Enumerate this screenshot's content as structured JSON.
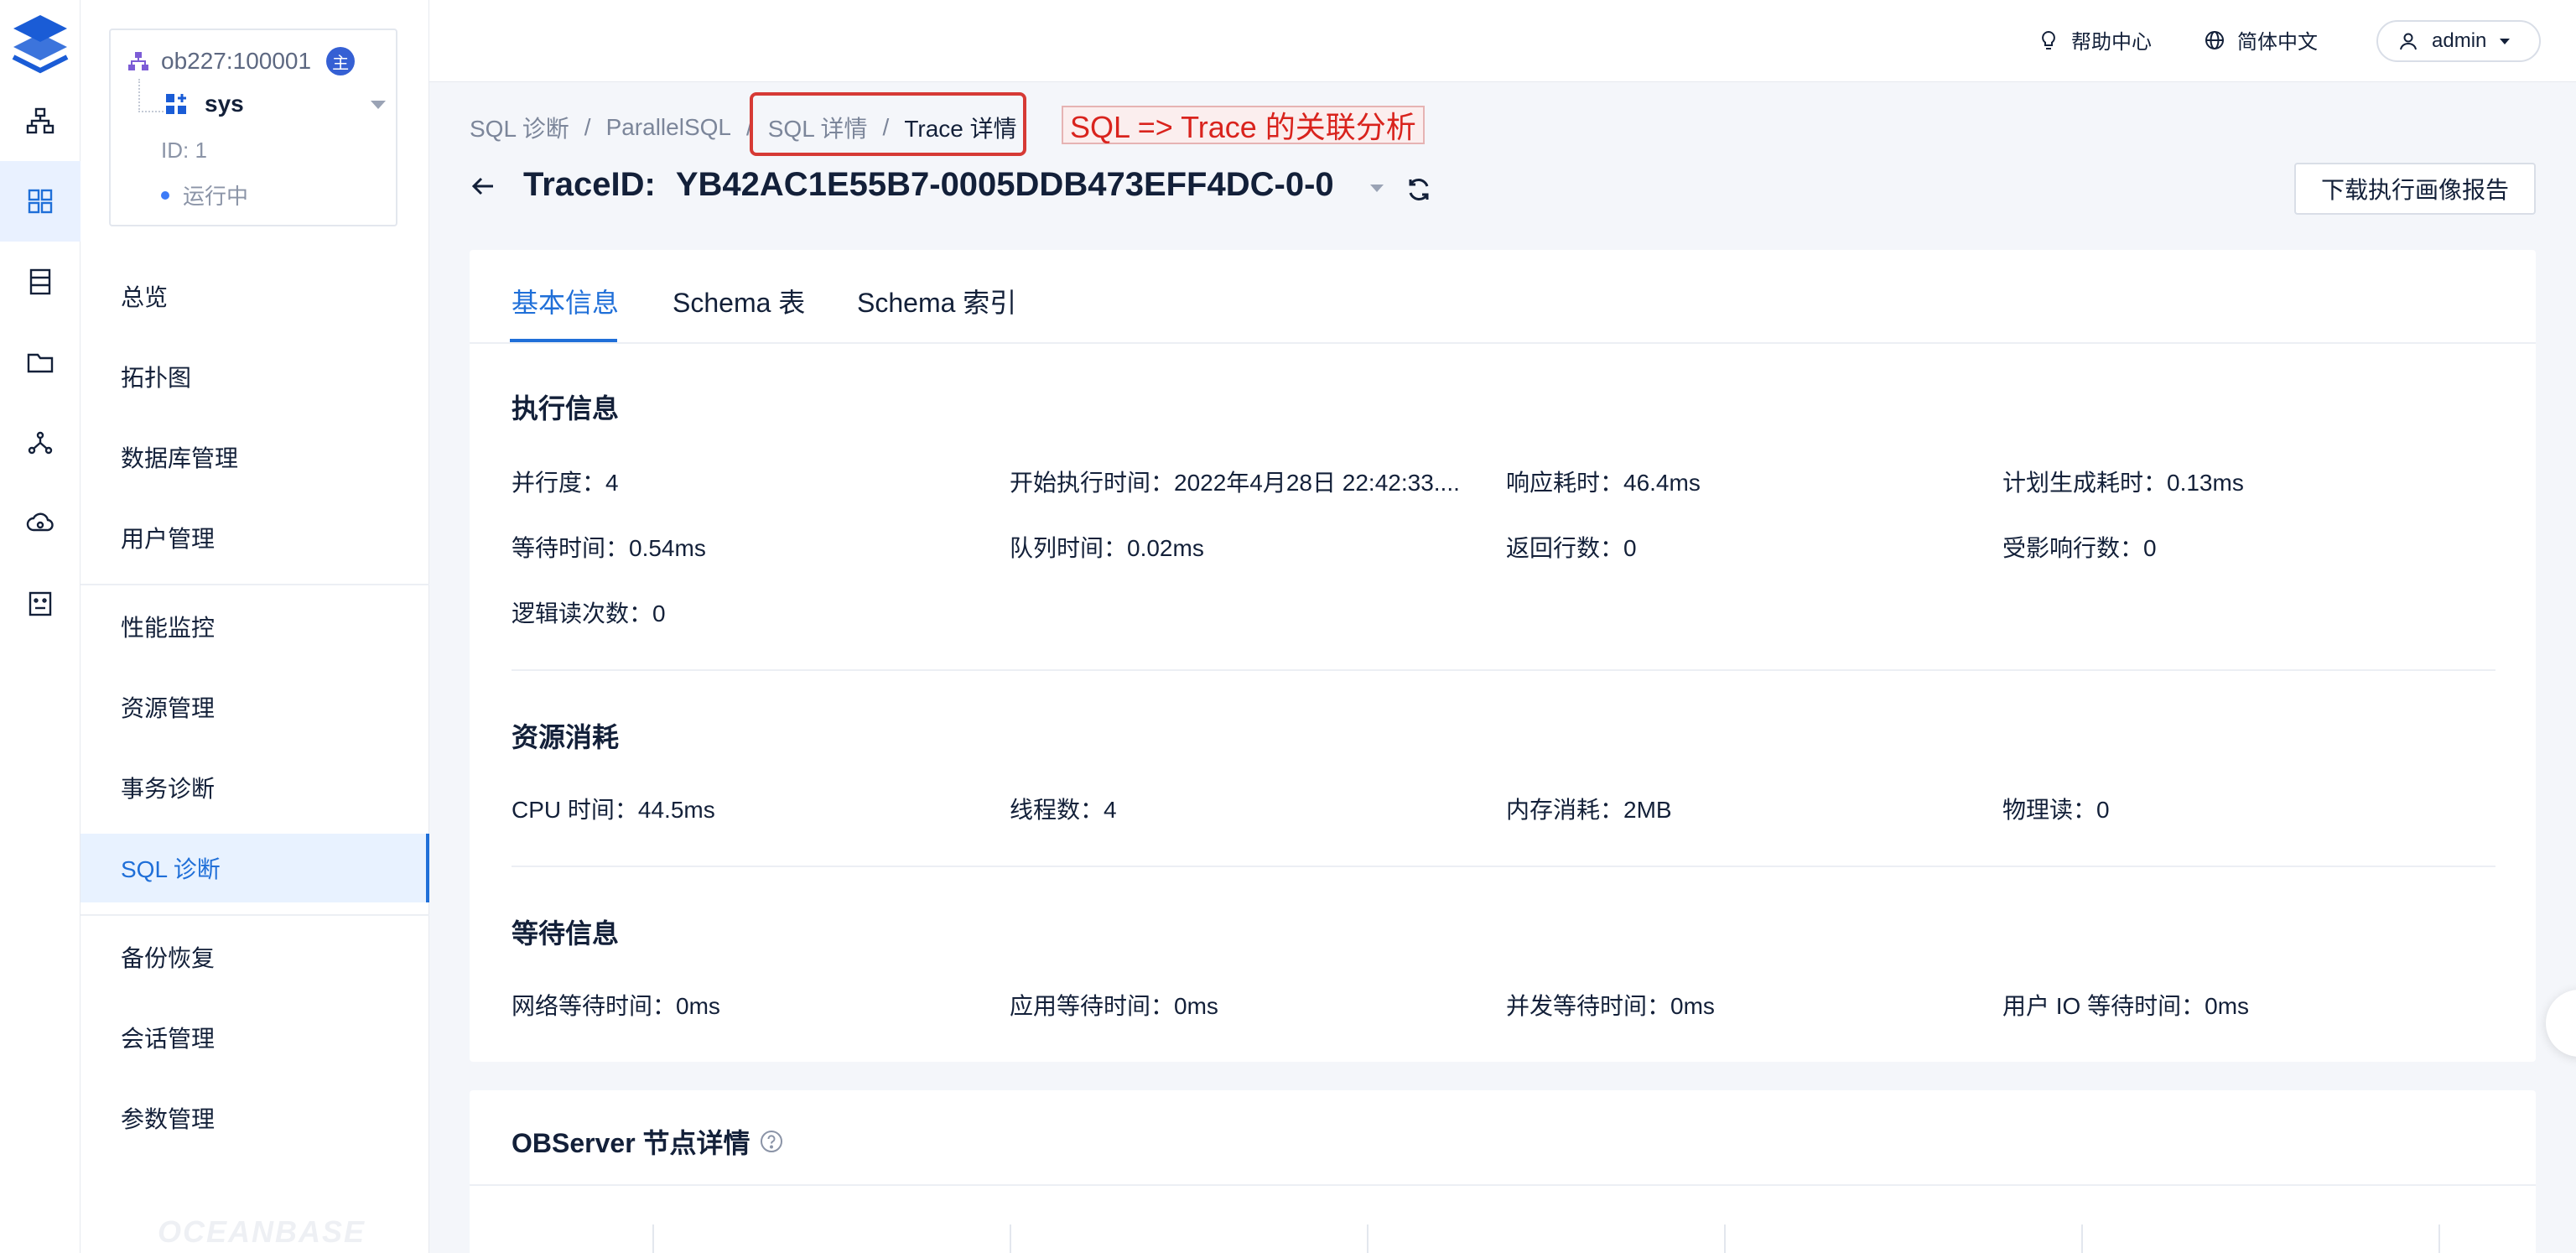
{
  "topbar": {
    "help_label": "帮助中心",
    "lang_label": "简体中文",
    "user_label": "admin"
  },
  "cluster": {
    "name": "ob227:100001",
    "badge": "主",
    "tenant": "sys",
    "id_label": "ID: 1",
    "status": "运行中"
  },
  "nav": {
    "items": [
      "总览",
      "拓扑图",
      "数据库管理",
      "用户管理",
      "性能监控",
      "资源管理",
      "事务诊断",
      "SQL 诊断",
      "备份恢复",
      "会话管理",
      "参数管理"
    ],
    "active": "SQL 诊断"
  },
  "watermark": "OCEANBASE",
  "breadcrumb": {
    "items": [
      "SQL 诊断",
      "ParallelSQL",
      "SQL 详情",
      "Trace 详情"
    ],
    "sep": "/"
  },
  "annotation": "SQL => Trace 的关联分析",
  "header": {
    "trace_label": "TraceID:",
    "trace_id": "YB42AC1E55B7-0005DDB473EFF4DC-0-0",
    "download_button": "下载执行画像报告"
  },
  "tabs": [
    "基本信息",
    "Schema 表",
    "Schema 索引"
  ],
  "sections": {
    "exec": {
      "title": "执行信息",
      "rows": [
        [
          "并行度：4",
          "开始执行时间：2022年4月28日 22:42:33....",
          "响应耗时：46.4ms",
          "计划生成耗时：0.13ms"
        ],
        [
          "等待时间：0.54ms",
          "队列时间：0.02ms",
          "返回行数：0",
          "受影响行数：0"
        ],
        [
          "逻辑读次数：0"
        ]
      ]
    },
    "resource": {
      "title": "资源消耗",
      "rows": [
        [
          "CPU 时间：44.5ms",
          "线程数：4",
          "内存消耗：2MB",
          "物理读：0"
        ]
      ]
    },
    "wait": {
      "title": "等待信息",
      "rows": [
        [
          "网络等待时间：0ms",
          "应用等待时间：0ms",
          "并发等待时间：0ms",
          "用户 IO 等待时间：0ms"
        ]
      ]
    }
  },
  "observer": {
    "title": "OBServer 节点详情"
  },
  "colors": {
    "accent": "#1f6fd8",
    "highlight": "#d63a35",
    "status_dot": "#3d7bf7"
  }
}
